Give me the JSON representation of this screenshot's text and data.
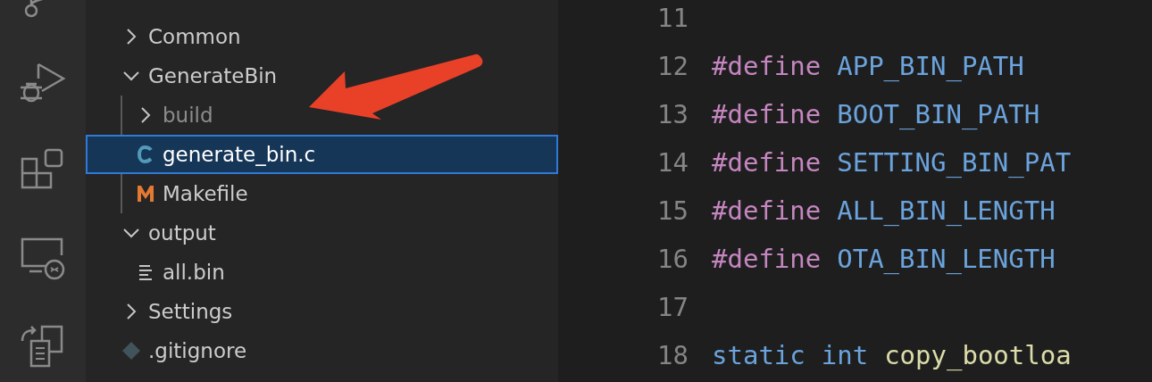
{
  "activity_bar": {
    "items": [
      {
        "kind": "source-control"
      },
      {
        "kind": "run-debug"
      },
      {
        "kind": "extensions"
      },
      {
        "kind": "remote"
      },
      {
        "kind": "transfer"
      }
    ]
  },
  "explorer": {
    "items": [
      {
        "label": "Common",
        "kind": "folder",
        "expanded": false,
        "selected": false,
        "ignored": false
      },
      {
        "label": "GenerateBin",
        "kind": "folder",
        "expanded": true,
        "selected": false,
        "ignored": false,
        "children": [
          {
            "label": "build",
            "kind": "folder",
            "expanded": false,
            "selected": false,
            "ignored": true
          },
          {
            "label": "generate_bin.c",
            "kind": "c-file",
            "selected": true,
            "ignored": false
          },
          {
            "label": "Makefile",
            "kind": "makefile",
            "selected": false,
            "ignored": false
          }
        ]
      },
      {
        "label": "output",
        "kind": "folder",
        "expanded": true,
        "selected": false,
        "ignored": false,
        "children": [
          {
            "label": "all.bin",
            "kind": "binary-file",
            "selected": false,
            "ignored": false
          }
        ]
      },
      {
        "label": "Settings",
        "kind": "folder",
        "expanded": false,
        "selected": false,
        "ignored": false
      },
      {
        "label": ".gitignore",
        "kind": "git-file",
        "selected": false,
        "ignored": false
      }
    ]
  },
  "editor": {
    "lines": [
      {
        "number": "11"
      },
      {
        "number": "12",
        "tokens": [
          {
            "kind": "directive",
            "text": "#define"
          },
          {
            "kind": "macro",
            "text": "APP_BIN_PATH"
          }
        ]
      },
      {
        "number": "13",
        "tokens": [
          {
            "kind": "directive",
            "text": "#define"
          },
          {
            "kind": "macro",
            "text": "BOOT_BIN_PATH"
          }
        ]
      },
      {
        "number": "14",
        "tokens": [
          {
            "kind": "directive",
            "text": "#define"
          },
          {
            "kind": "macro",
            "text": "SETTING_BIN_PAT"
          }
        ]
      },
      {
        "number": "15",
        "tokens": [
          {
            "kind": "directive",
            "text": "#define"
          },
          {
            "kind": "macro",
            "text": "ALL_BIN_LENGTH"
          }
        ]
      },
      {
        "number": "16",
        "tokens": [
          {
            "kind": "directive",
            "text": "#define"
          },
          {
            "kind": "macro",
            "text": "OTA_BIN_LENGTH"
          }
        ]
      },
      {
        "number": "17"
      },
      {
        "number": "18",
        "tokens": [
          {
            "kind": "keyword",
            "text": "static"
          },
          {
            "kind": "keyword",
            "text": "int"
          },
          {
            "kind": "function",
            "text": "copy_bootloa"
          }
        ]
      }
    ]
  }
}
